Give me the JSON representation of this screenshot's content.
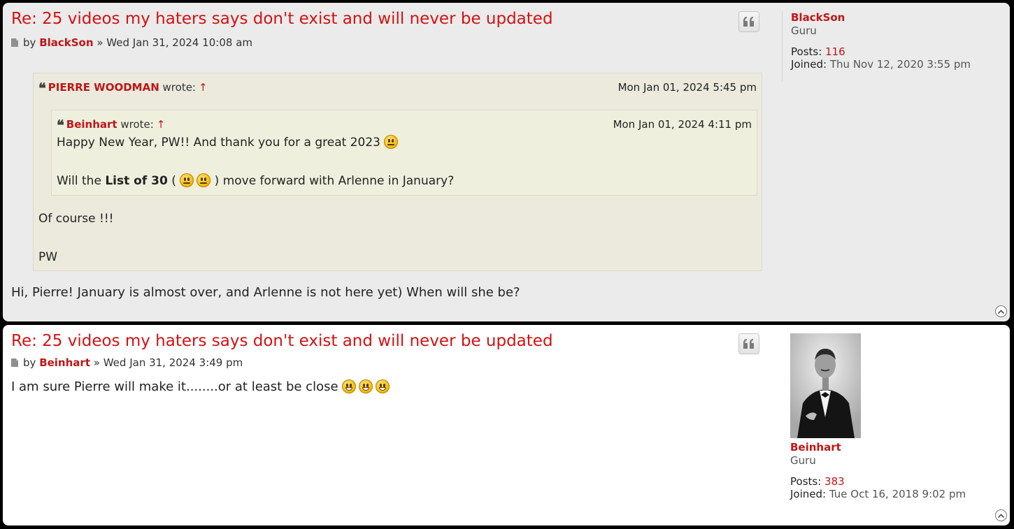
{
  "posts": [
    {
      "title": "Re: 25 videos my haters says don't exist and will never be updated",
      "by_prefix": "by",
      "author": "BlackSon",
      "separator": "»",
      "date": "Wed Jan 31, 2024 10:08 am",
      "quote": {
        "author": "PIERRE WOODMAN",
        "wrote": "wrote:",
        "arrow": "↑",
        "date": "Mon Jan 01, 2024 5:45 pm",
        "nested": {
          "author": "Beinhart",
          "wrote": "wrote:",
          "arrow": "↑",
          "date": "Mon Jan 01, 2024 4:11 pm",
          "line1": "Happy New Year, PW!! And thank you for a great 2023",
          "line2_pre": "Will the ",
          "line2_bold": "List of 30",
          "line2_open": " (",
          "line2_post": ") move forward with Arlenne in January?"
        },
        "reply_line1": "Of course !!!",
        "reply_line2": "PW"
      },
      "body": "Hi, Pierre! January is almost over, and Arlenne is not here yet) When will she be?",
      "profile": {
        "name": "BlackSon",
        "rank": "Guru",
        "posts_label": "Posts:",
        "posts": "116",
        "joined_label": "Joined:",
        "joined": "Thu Nov 12, 2020 3:55 pm"
      }
    },
    {
      "title": "Re: 25 videos my haters says don't exist and will never be updated",
      "by_prefix": "by",
      "author": "Beinhart",
      "separator": "»",
      "date": "Wed Jan 31, 2024 3:49 pm",
      "body": "I am sure Pierre will make it........or at least be close",
      "profile": {
        "name": "Beinhart",
        "rank": "Guru",
        "posts_label": "Posts:",
        "posts": "383",
        "joined_label": "Joined:",
        "joined": "Tue Oct 16, 2018 9:02 pm"
      }
    }
  ],
  "icons": {
    "quote_button": "quote-icon",
    "top": "back-to-top-icon",
    "post_file": "post-file-icon",
    "emoji_neutral": "neutral-face-emoji",
    "emoji_grin": "grin-emoji"
  },
  "colors": {
    "link": "#c01616",
    "title": "#d31212",
    "post_bg_alt": "#ebebeb",
    "quote_bg": "#ebeadd"
  }
}
